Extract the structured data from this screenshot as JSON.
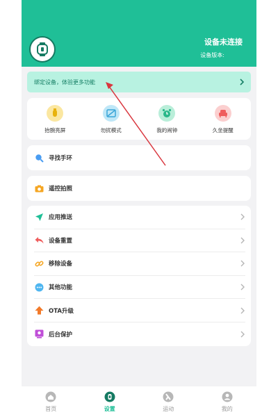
{
  "header": {
    "status": "设备未连接",
    "version_label": "设备版本:"
  },
  "banner": {
    "text": "绑定设备，体验更多功能"
  },
  "quick_actions": [
    {
      "label": "抬腕亮屏",
      "icon": "wrist-raise-icon",
      "bg": "#fbe7a1",
      "fg": "#e8b20c"
    },
    {
      "label": "勿扰模式",
      "icon": "do-not-disturb-icon",
      "bg": "#bfe7f7",
      "fg": "#3aa5d8"
    },
    {
      "label": "我的闹钟",
      "icon": "alarm-clock-icon",
      "bg": "#b9eed9",
      "fg": "#2ab88a"
    },
    {
      "label": "久坐提醒",
      "icon": "sedentary-reminder-icon",
      "bg": "#fbcfcf",
      "fg": "#ef5d5d"
    }
  ],
  "find_band": {
    "label": "寻找手环"
  },
  "remote_photo": {
    "label": "遥控拍照"
  },
  "settings_list": [
    {
      "label": "应用推送"
    },
    {
      "label": "设备重置"
    },
    {
      "label": "移除设备"
    },
    {
      "label": "其他功能"
    },
    {
      "label": "OTA升级"
    },
    {
      "label": "后台保护"
    }
  ],
  "tabs": [
    {
      "label": "首页"
    },
    {
      "label": "设置"
    },
    {
      "label": "运动"
    },
    {
      "label": "我的"
    }
  ],
  "active_tab": "设置",
  "colors": {
    "accent": "#1fbf97",
    "banner_bg": "#b8f2e1",
    "annotation_arrow": "#d9363e"
  }
}
